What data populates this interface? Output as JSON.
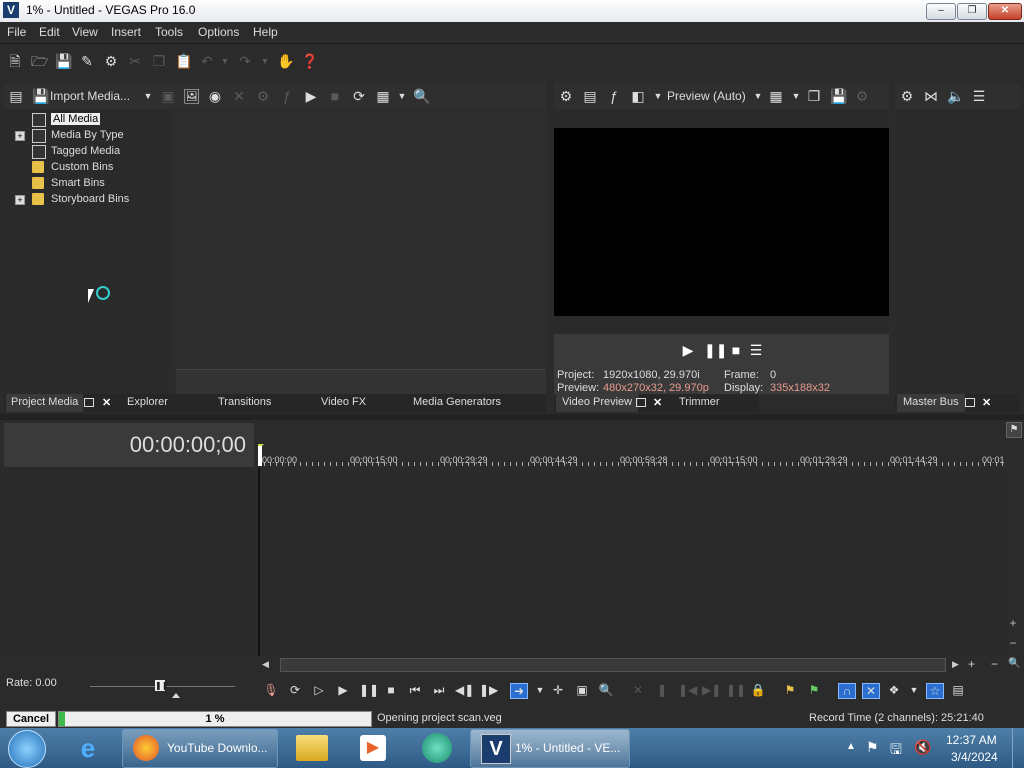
{
  "window": {
    "title": "1% - Untitled - VEGAS Pro 16.0",
    "logo": "V"
  },
  "menu": [
    "File",
    "Edit",
    "View",
    "Insert",
    "Tools",
    "Options",
    "Help"
  ],
  "media_toolbar": {
    "import_label": "Import Media..."
  },
  "media_tree": [
    {
      "label": "All Media",
      "expander": false,
      "icon": "stack-icon",
      "selected": true
    },
    {
      "label": "Media By Type",
      "expander": true,
      "icon": "stack-icon"
    },
    {
      "label": "Tagged Media",
      "expander": false,
      "icon": "stack-icon"
    },
    {
      "label": "Custom Bins",
      "expander": false,
      "icon": "folder-icon"
    },
    {
      "label": "Smart Bins",
      "expander": false,
      "icon": "folder-icon"
    },
    {
      "label": "Storyboard Bins",
      "expander": true,
      "icon": "folder-icon"
    }
  ],
  "left_tabs": {
    "project_media": "Project Media",
    "explorer": "Explorer",
    "transitions": "Transitions",
    "video_fx": "Video FX",
    "media_generators": "Media Generators"
  },
  "preview": {
    "mode_label": "Preview (Auto)",
    "project_label": "Project:",
    "project_value": "1920x1080, 29.970i",
    "preview_label": "Preview:",
    "preview_value": "480x270x32, 29.970p",
    "frame_label": "Frame:",
    "frame_value": "0",
    "display_label": "Display:",
    "display_value": "335x188x32"
  },
  "preview_tabs": {
    "video_preview": "Video Preview",
    "trimmer": "Trimmer"
  },
  "master_tabs": {
    "master_bus": "Master Bus"
  },
  "timeline": {
    "timecode": "00:00:00;00",
    "ticks": [
      "00:00:00",
      "00:00:15;00",
      "00:00:29;29",
      "00:00:44;29",
      "00:00:59;28",
      "00:01:15;00",
      "00:01:29;29",
      "00:01:44;29",
      "00:01"
    ],
    "rate": "Rate: 0.00"
  },
  "status": {
    "cancel": "Cancel",
    "progress_text": "1 %",
    "progress_fraction": 0.01,
    "message": "Opening project scan.veg",
    "record_time": "Record Time (2 channels): 25:21:40"
  },
  "taskbar": {
    "items": [
      {
        "label": "YouTube Downlo...",
        "icon": "firefox-icon"
      },
      {
        "label": "1% - Untitled - VE...",
        "icon": "vegas-icon"
      }
    ],
    "time": "12:37 AM",
    "date": "3/4/2024"
  }
}
